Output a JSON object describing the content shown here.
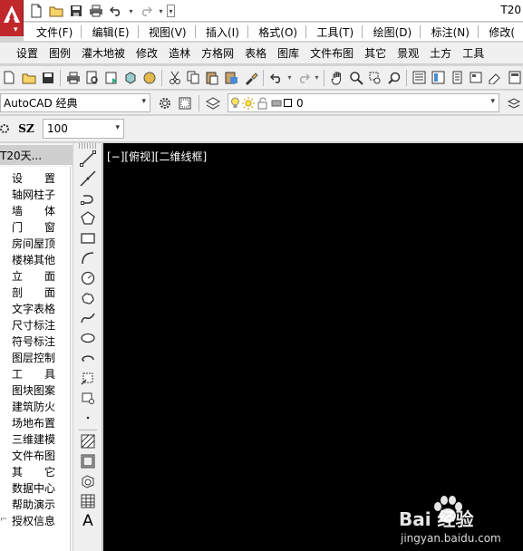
{
  "titlebar": {
    "title": "T20",
    "app_icon": "autocad-logo-icon"
  },
  "menubar": {
    "items": [
      "文件(F)",
      "编辑(E)",
      "视图(V)",
      "插入(I)",
      "格式(O)",
      "工具(T)",
      "绘图(D)",
      "标注(N)",
      "修改("
    ]
  },
  "t20menu": {
    "items": [
      "设置",
      "图例",
      "灌木地被",
      "修改",
      "造林",
      "方格网",
      "表格",
      "图库",
      "文件布图",
      "其它",
      "景观",
      "土方",
      "工具"
    ]
  },
  "workspace": {
    "selected": "AutoCAD 经典"
  },
  "layer": {
    "current": "0"
  },
  "szbar": {
    "label": "SZ",
    "value": "100"
  },
  "sidepanel": {
    "title": "T20天...",
    "items": [
      "设　置",
      "轴网柱子",
      "墙　体",
      "门　窗",
      "房间屋顶",
      "楼梯其他",
      "立　面",
      "剖　面",
      "文字表格",
      "尺寸标注",
      "符号标注",
      "图层控制",
      "工　具",
      "图块图案",
      "建筑防火",
      "场地布置",
      "三维建模",
      "文件布图",
      "其　它",
      "数据中心",
      "帮助演示",
      "授权信息"
    ]
  },
  "canvas": {
    "viewport_label": "[−][俯视][二维线框]"
  },
  "drawbar": {
    "text_tool": "A"
  },
  "watermark": {
    "brand": "Bai 经验",
    "url": "jingyan.baidu.com"
  },
  "colors": {
    "app_red": "#c0282c",
    "canvas": "#000000",
    "toolbar": "#f0f0f0"
  }
}
